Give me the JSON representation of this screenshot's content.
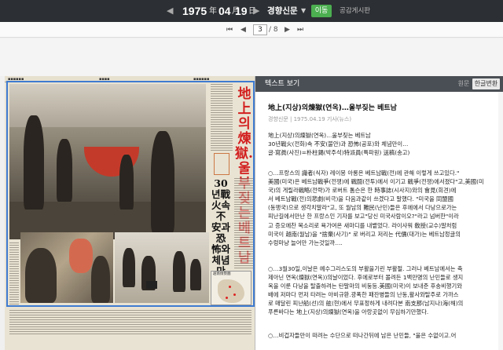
{
  "topbar": {
    "year": "1975",
    "year_unit": "年",
    "month": "04",
    "month_unit": "月",
    "day": "19",
    "day_unit": "日",
    "newspaper": "경향신문",
    "go_label": "이동",
    "notice_label": "공감게시판"
  },
  "pager": {
    "current_page": "3",
    "total": "/ 8"
  },
  "newspaper_image": {
    "headline_red": "地上의煉獄…울부짖는베트남",
    "headline_black": "30년戰火속不安과恐怖와체념만이…",
    "map_title": "越南情勢圖"
  },
  "panel": {
    "title": "텍스트 보기",
    "tab_original": "원문",
    "tab_korean": "한글변환",
    "article_title": "地上(지상)의煉獄(연옥)…울부짖는 베트남",
    "article_meta": "경향신문 | 1975.04.19 기사(뉴스)",
    "intro": [
      "地上(지상)의煉獄(연옥)…울부짖는 베트남",
      "30년戰火(전화)속 不安(불안)과 恐怖(공포)와 체념만이…",
      "글·寫眞(사진)=朴柱錫(박주석)特派員(특파원) 送稿(송고)"
    ],
    "body": [
      "○…프랑스의 識者(식자) 레이몽 아롱은 베트남戰(전)에 관해 이렇게 쓰고있다.\"",
      "美國(미국)은 베트남戰爭(전쟁)에 戰鬪(전투)에서 이기고 戰爭(전쟁)에서졌다\"고,美國(미",
      "국)의 게릴라戰略(전략)가 로버트 톰슨은 한 時事誌(시사지)와의 會見(회견)에",
      "서 베트남戰(전)의悲劇(비극)을 다음과같이 쓰겠다고 말했다. \"미국을 同盟國",
      "(동맹국)으로 생각치말라\"고, 또 월남의 難民(난민)들은 후에에서 다낭으로가는",
      "피난길에서만난 한 프랑스인 기자를 보고\"당신 미국사람이오?\"라고 넘버한\"이라",
      "고 증오에찬 목소리로 욕가여온 새마디를 내뱉었다. 라이샤워 敎授(교수)말처럼",
      "미국이 越南(월남)을 \"捨棄(사기)\" 로 버리고 저리는 代價(대가)는 베트남정글의",
      "수렁마냥 늘어만 가는것일까…."
    ],
    "body2": [
      "○…3월30일,이날은 예수그리스도의 부활을기린 부활절. 그러나 베트남에서는 축",
      "제아닌 연옥(煉獄(연옥))의날이었다. 후에로부터 몰려든 1백만명의 난민들로 생지",
      "옥을 이룬 다낭을 탈출하려는 탄말마의 비둥등.美國(미국)이 보내준 후송비행기와",
      "배에 저마다 먼저 타려는 아비규환.광폭한 패잔병들의 난동,활사와탈주로 가까스",
      "로 매달린 피난船(선)의 舷(현)에서 무표정하게 내려다본 南支那(남지나)海(해)의",
      "푸른바다는 地上(지상)의煉獄(연옥)을 아랑곳없이 무심하기만했다."
    ],
    "body3": [
      "○…비겁자들만이 떠려는 수단으로 떠나간뒤에 남은 난민들, \"울은 수없이고.어"
    ]
  }
}
